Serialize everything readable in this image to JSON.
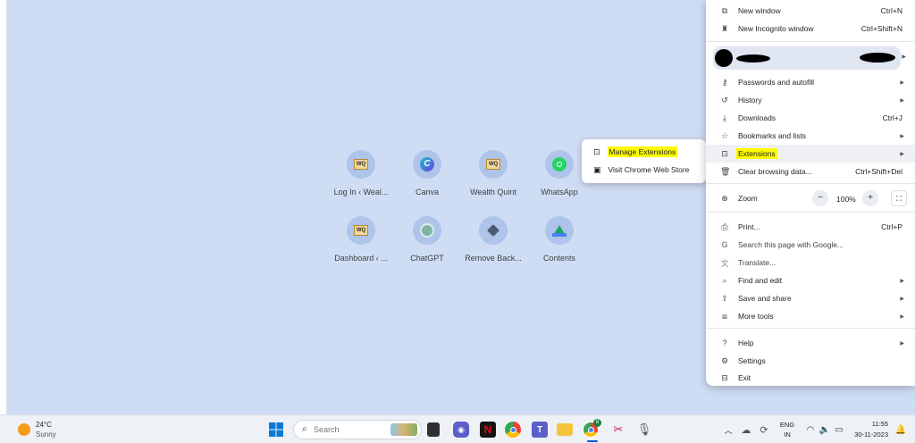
{
  "shortcuts": [
    {
      "label": "Log In ‹ Weal...",
      "icon": "wealthquint-icon"
    },
    {
      "label": "Canva",
      "icon": "canva-icon"
    },
    {
      "label": "Wealth Quint",
      "icon": "wealthquint-icon"
    },
    {
      "label": "WhatsApp",
      "icon": "whatsapp-icon"
    },
    {
      "label": "Dashboard ‹ ...",
      "icon": "wealthquint-icon"
    },
    {
      "label": "ChatGPT",
      "icon": "chatgpt-icon"
    },
    {
      "label": "Remove Back...",
      "icon": "remove-bg-icon"
    },
    {
      "label": "Contents",
      "icon": "google-drive-icon"
    }
  ],
  "extensions_submenu": {
    "manage": "Manage Extensions",
    "store": "Visit Chrome Web Store",
    "highlight_color": "#fffb00"
  },
  "menu": {
    "new_window": {
      "label": "New window",
      "shortcut": "Ctrl+N"
    },
    "new_incognito": {
      "label": "New Incognito window",
      "shortcut": "Ctrl+Shift+N"
    },
    "passwords": {
      "label": "Passwords and autofill"
    },
    "history": {
      "label": "History"
    },
    "downloads": {
      "label": "Downloads",
      "shortcut": "Ctrl+J"
    },
    "bookmarks": {
      "label": "Bookmarks and lists"
    },
    "extensions": {
      "label": "Extensions"
    },
    "clear": {
      "label": "Clear browsing data...",
      "shortcut": "Ctrl+Shift+Del"
    },
    "zoom": {
      "label": "Zoom",
      "minus": "−",
      "value": "100%",
      "plus": "+"
    },
    "print": {
      "label": "Print...",
      "shortcut": "Ctrl+P"
    },
    "search_google": {
      "label": "Search this page with Google..."
    },
    "translate": {
      "label": "Translate..."
    },
    "find_edit": {
      "label": "Find and edit"
    },
    "save_share": {
      "label": "Save and share"
    },
    "more_tools": {
      "label": "More tools"
    },
    "help": {
      "label": "Help"
    },
    "settings": {
      "label": "Settings"
    },
    "exit": {
      "label": "Exit"
    }
  },
  "taskbar": {
    "weather": {
      "temp": "24°C",
      "condition": "Sunny"
    },
    "search_placeholder": "Search",
    "language": {
      "line1": "ENG",
      "line2": "IN"
    },
    "clock": {
      "time": "11:55",
      "date": "30-11-2023"
    },
    "chrome_badge": "8"
  },
  "colors": {
    "desktop_bg": "#cfddf4",
    "accent": "#0b57d0"
  }
}
